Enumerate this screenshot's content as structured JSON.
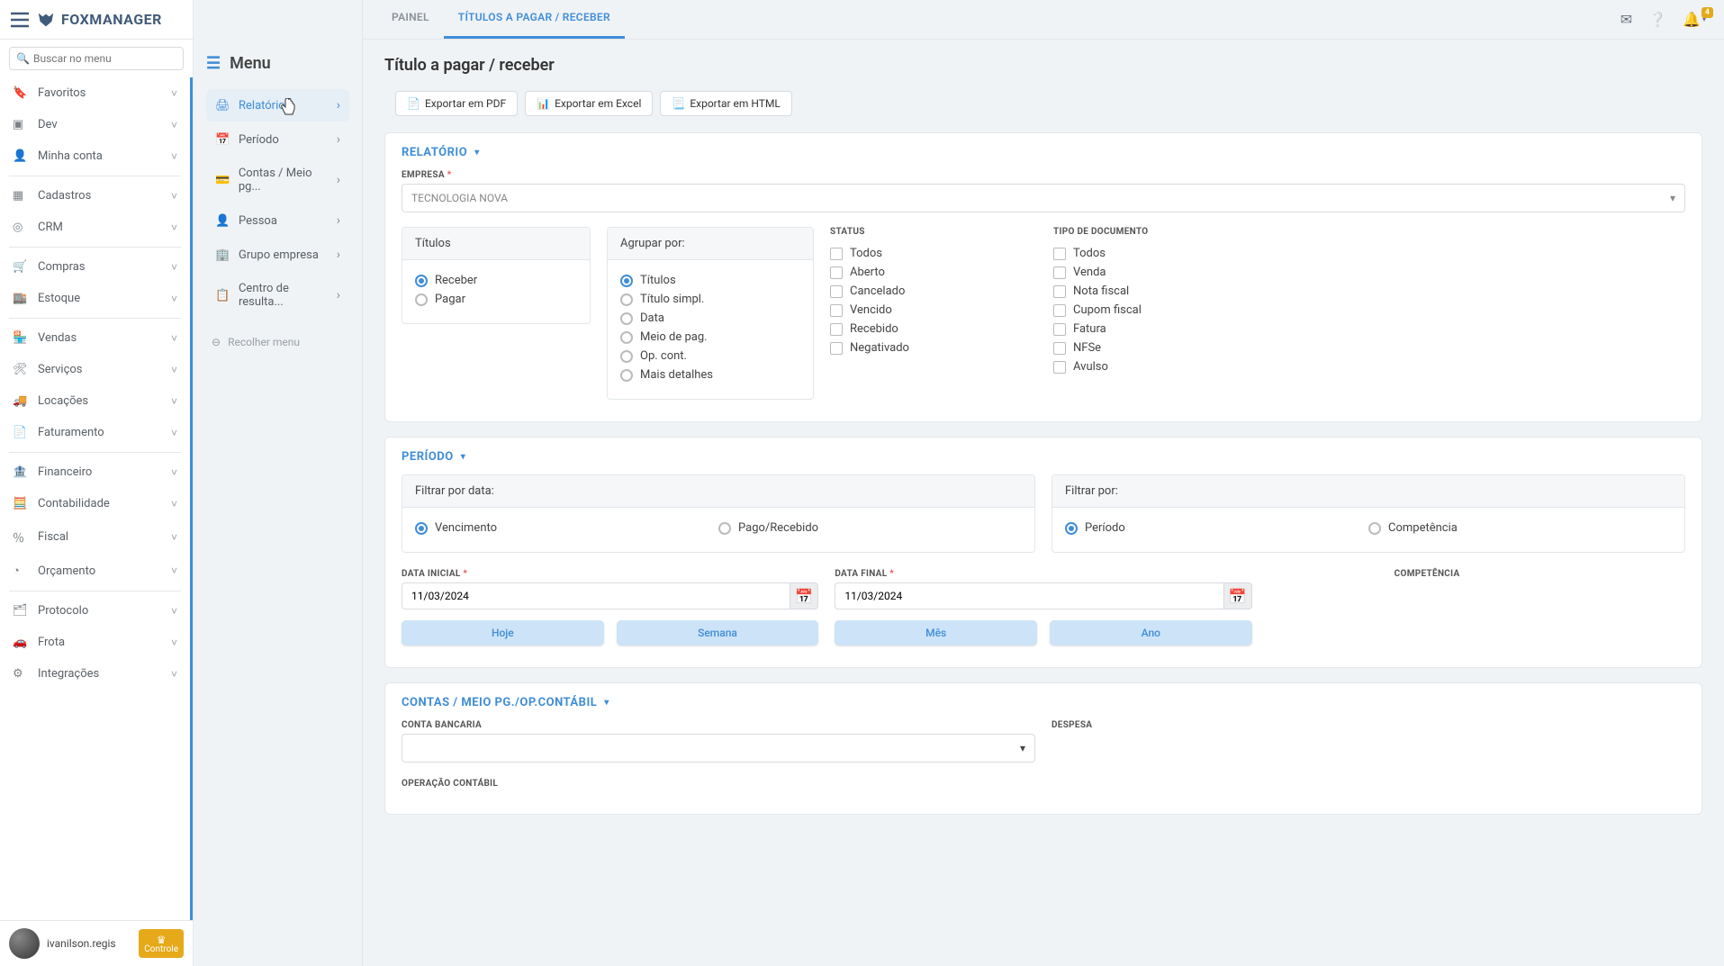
{
  "app": {
    "name": "FOXMANAGER"
  },
  "search": {
    "placeholder": "Buscar no menu"
  },
  "sidebar": {
    "items": [
      {
        "label": "Favoritos",
        "name": "favoritos"
      },
      {
        "label": "Dev",
        "name": "dev"
      },
      {
        "label": "Minha conta",
        "name": "minha-conta"
      },
      {
        "label": "Cadastros",
        "name": "cadastros"
      },
      {
        "label": "CRM",
        "name": "crm"
      },
      {
        "label": "Compras",
        "name": "compras"
      },
      {
        "label": "Estoque",
        "name": "estoque"
      },
      {
        "label": "Vendas",
        "name": "vendas"
      },
      {
        "label": "Serviços",
        "name": "servicos"
      },
      {
        "label": "Locações",
        "name": "locacoes"
      },
      {
        "label": "Faturamento",
        "name": "faturamento"
      },
      {
        "label": "Financeiro",
        "name": "financeiro"
      },
      {
        "label": "Contabilidade",
        "name": "contabilidade"
      },
      {
        "label": "Fiscal",
        "name": "fiscal"
      },
      {
        "label": "Orçamento",
        "name": "orcamento"
      },
      {
        "label": "Protocolo",
        "name": "protocolo"
      },
      {
        "label": "Frota",
        "name": "frota"
      },
      {
        "label": "Integrações",
        "name": "integracoes"
      }
    ]
  },
  "user": {
    "name": "ivanilson.regis",
    "badge": "Controle"
  },
  "notifications": {
    "count": "4"
  },
  "submenu": {
    "title": "Menu",
    "items": [
      {
        "label": "Relatório",
        "name": "relatorio",
        "active": true
      },
      {
        "label": "Período",
        "name": "periodo"
      },
      {
        "label": "Contas / Meio pg...",
        "name": "contas-meio-pg"
      },
      {
        "label": "Pessoa",
        "name": "pessoa"
      },
      {
        "label": "Grupo empresa",
        "name": "grupo-empresa"
      },
      {
        "label": "Centro de resulta...",
        "name": "centro-resultado"
      }
    ],
    "collapse": "Recolher menu"
  },
  "tabs": [
    {
      "label": "PAINEL",
      "name": "painel"
    },
    {
      "label": "TÍTULOS A PAGAR / RECEBER",
      "name": "titulos",
      "active": true
    }
  ],
  "page": {
    "title": "Título a pagar / receber"
  },
  "exports": {
    "pdf": "Exportar em PDF",
    "excel": "Exportar em Excel",
    "html": "Exportar em HTML"
  },
  "report": {
    "heading": "RELATÓRIO",
    "empresa_label": "EMPRESA",
    "empresa_value": "TECNOLOGIA NOVA",
    "titulos_heading": "Títulos",
    "titulos_options": [
      "Receber",
      "Pagar"
    ],
    "titulos_selected": "Receber",
    "agrupar_heading": "Agrupar por:",
    "agrupar_options": [
      "Títulos",
      "Título simpl.",
      "Data",
      "Meio de pag.",
      "Op. cont.",
      "Mais detalhes"
    ],
    "agrupar_selected": "Títulos",
    "status_heading": "STATUS",
    "status_options": [
      "Todos",
      "Aberto",
      "Cancelado",
      "Vencido",
      "Recebido",
      "Negativado"
    ],
    "tipodoc_heading": "TIPO DE DOCUMENTO",
    "tipodoc_options": [
      "Todos",
      "Venda",
      "Nota fiscal",
      "Cupom fiscal",
      "Fatura",
      "NFSe",
      "Avulso"
    ]
  },
  "periodo": {
    "heading": "PERÍODO",
    "filtrar_data_heading": "Filtrar por data:",
    "filtrar_data_options": [
      "Vencimento",
      "Pago/Recebido"
    ],
    "filtrar_data_selected": "Vencimento",
    "filtrar_por_heading": "Filtrar por:",
    "filtrar_por_options": [
      "Período",
      "Competência"
    ],
    "filtrar_por_selected": "Período",
    "data_inicial_label": "DATA INICIAL",
    "data_inicial_value": "11/03/2024",
    "data_final_label": "DATA FINAL",
    "data_final_value": "11/03/2024",
    "competencia_label": "COMPETÊNCIA",
    "shortcuts": [
      "Hoje",
      "Semana",
      "Mês",
      "Ano"
    ]
  },
  "contas": {
    "heading": "CONTAS / MEIO PG./OP.CONTÁBIL",
    "conta_bancaria_label": "CONTA BANCARIA",
    "despesa_label": "DESPESA",
    "operacao_label": "OPERAÇÃO CONTÁBIL"
  }
}
